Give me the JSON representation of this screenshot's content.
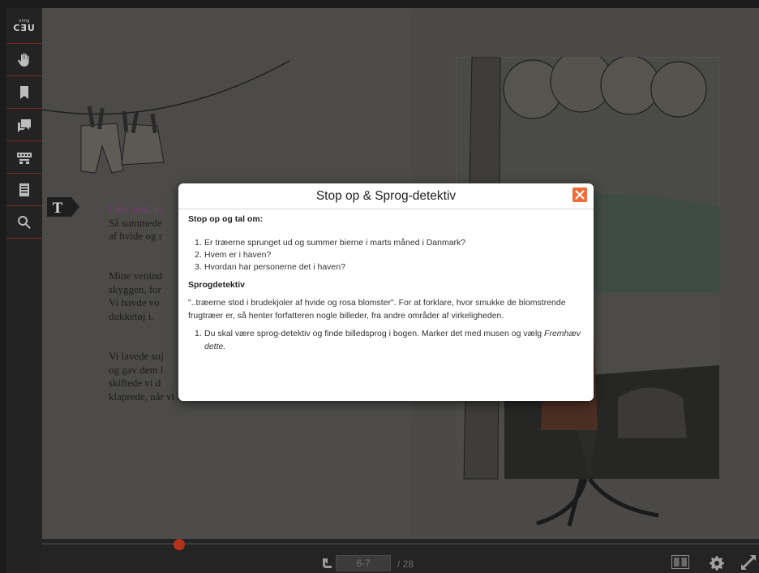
{
  "sidebar": {
    "logo_top": "eling",
    "logo_bottom": "CƎU",
    "items": [
      {
        "name": "hand-icon"
      },
      {
        "name": "bookmark-icon"
      },
      {
        "name": "chat-icon"
      },
      {
        "name": "keyboard-icon"
      },
      {
        "name": "contents-list-icon"
      },
      {
        "name": "search-icon"
      }
    ],
    "accent_color": "#b3321b"
  },
  "book": {
    "badge_letter": "T",
    "story": {
      "p1": [
        "I det land, jo",
        "Så summede",
        "af hvide og r"
      ],
      "p2": [
        "Mine venind",
        "skyggen, for",
        "Vi havde vo",
        "dukketøj i."
      ],
      "p3": [
        "Vi lavede suj",
        "og gav dem l",
        "skiftede vi d",
        "klaprede, når vi kom for at vaske dem."
      ]
    }
  },
  "modal": {
    "title": "Stop op & Sprog-detektiv",
    "close_icon": "close-icon",
    "section1_heading": "Stop op og tal om:",
    "questions": [
      {
        "num": "1.",
        "text": "Er træerne sprunget ud og summer bierne i marts måned i Danmark?"
      },
      {
        "num": "2.",
        "text": "Hvem er i haven?"
      },
      {
        "num": "3.",
        "text": "Hvordan har personerne det i haven?"
      }
    ],
    "section2_heading": "Sprogdetektiv",
    "paragraph": "\"..træerne stod i brudekjoler af hvide og rosa blomster\". For at forklare, hvor smukke de blomstrende frugtræer er, så henter forfatteren nogle billeder, fra andre områder af virkeligheden.",
    "task_num": "1.",
    "task_text": "Du skal være sprog-detektiv og finde billedsprog i bogen. Marker det med musen og vælg ",
    "task_emph": "Fremhæv dette."
  },
  "bottombar": {
    "page_value": "6-7",
    "page_total": "/ 28"
  }
}
